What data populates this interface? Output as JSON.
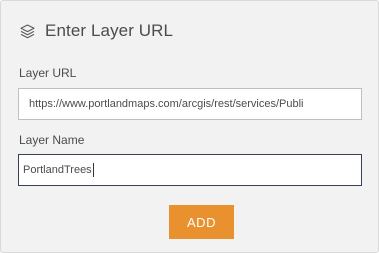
{
  "header": {
    "icon": "layers-icon",
    "title": "Enter Layer URL"
  },
  "layer_url": {
    "label": "Layer URL",
    "value": "https://www.portlandmaps.com/arcgis/rest/services/Publi"
  },
  "layer_name": {
    "label": "Layer Name",
    "value": "PortlandTrees"
  },
  "actions": {
    "add_label": "ADD"
  },
  "colors": {
    "panel_background": "#f2f2f2",
    "button_accent": "#e8912e",
    "focused_border": "#36405a"
  }
}
